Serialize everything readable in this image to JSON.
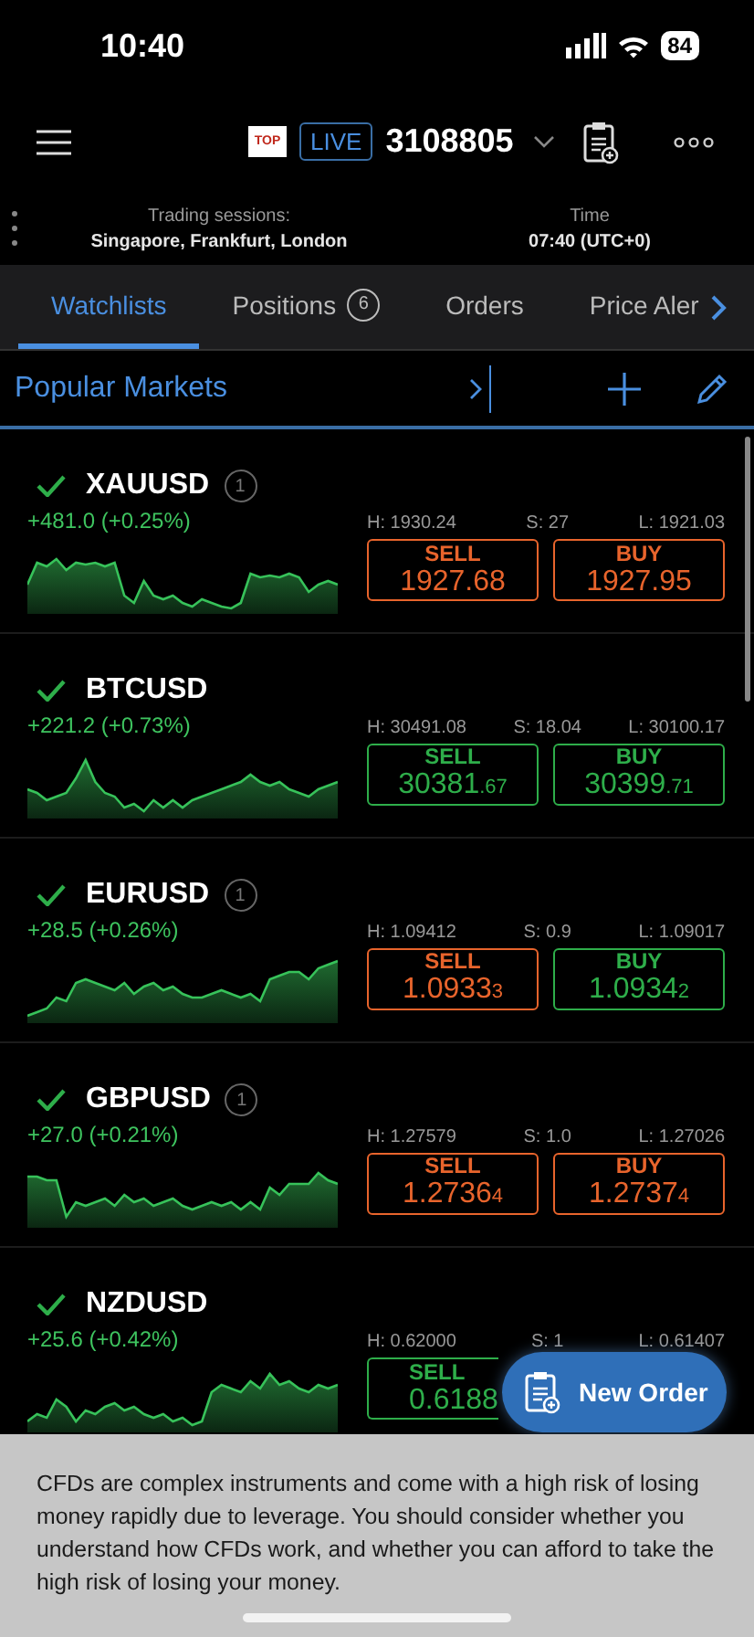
{
  "status_bar": {
    "time": "10:40",
    "battery": "84"
  },
  "header": {
    "broker_badge": "TOP",
    "account_type": "LIVE",
    "account_number": "3108805"
  },
  "sessions": {
    "label": "Trading sessions:",
    "value": "Singapore, Frankfurt, London",
    "time_label": "Time",
    "time_value": "07:40 (UTC+0)"
  },
  "tabs": [
    {
      "label": "Watchlists",
      "selected": true
    },
    {
      "label": "Positions",
      "count": "6",
      "selected": false
    },
    {
      "label": "Orders",
      "selected": false
    },
    {
      "label": "Price Aler",
      "selected": false
    }
  ],
  "watchlist": {
    "title": "Popular Markets"
  },
  "rows": [
    {
      "symbol": "XAUUSD",
      "badge": "1",
      "change": "+481.0 (+0.25%)",
      "high": "H: 1930.24",
      "spread": "S: 27",
      "low": "L: 1921.03",
      "sell": {
        "label": "SELL",
        "price": "1927.68",
        "color": "#e8642c"
      },
      "buy": {
        "label": "BUY",
        "price": "1927.95",
        "color": "#e8642c"
      }
    },
    {
      "symbol": "BTCUSD",
      "change": "+221.2 (+0.73%)",
      "high": "H: 30491.08",
      "spread": "S: 18.04",
      "low": "L: 30100.17",
      "sell": {
        "label": "SELL",
        "price": "30381",
        "small": ".67",
        "color": "#2eae4a"
      },
      "buy": {
        "label": "BUY",
        "price": "30399",
        "small": ".71",
        "color": "#2eae4a"
      }
    },
    {
      "symbol": "EURUSD",
      "badge": "1",
      "change": "+28.5 (+0.26%)",
      "high": "H: 1.09412",
      "spread": "S: 0.9",
      "low": "L: 1.09017",
      "sell": {
        "label": "SELL",
        "price": "1.0933",
        "small": "3",
        "color": "#e8642c"
      },
      "buy": {
        "label": "BUY",
        "price": "1.0934",
        "small": "2",
        "color": "#2eae4a"
      }
    },
    {
      "symbol": "GBPUSD",
      "badge": "1",
      "change": "+27.0 (+0.21%)",
      "high": "H: 1.27579",
      "spread": "S: 1.0",
      "low": "L: 1.27026",
      "sell": {
        "label": "SELL",
        "price": "1.2736",
        "small": "4",
        "color": "#e8642c"
      },
      "buy": {
        "label": "BUY",
        "price": "1.2737",
        "small": "4",
        "color": "#e8642c"
      }
    },
    {
      "symbol": "NZDUSD",
      "change": "+25.6 (+0.42%)",
      "high": "H: 0.62000",
      "spread": "S: 1",
      "low": "L: 0.61407",
      "sell": {
        "label": "SELL",
        "price": "0.6188",
        "color": "#2eae4a"
      }
    }
  ],
  "new_order_button": {
    "label": "New Order"
  },
  "disclaimer": "CFDs are complex instruments and come with a high risk of losing money rapidly due to leverage. You should consider whether you understand how CFDs work, and whether you can afford to take the high risk of losing your money."
}
